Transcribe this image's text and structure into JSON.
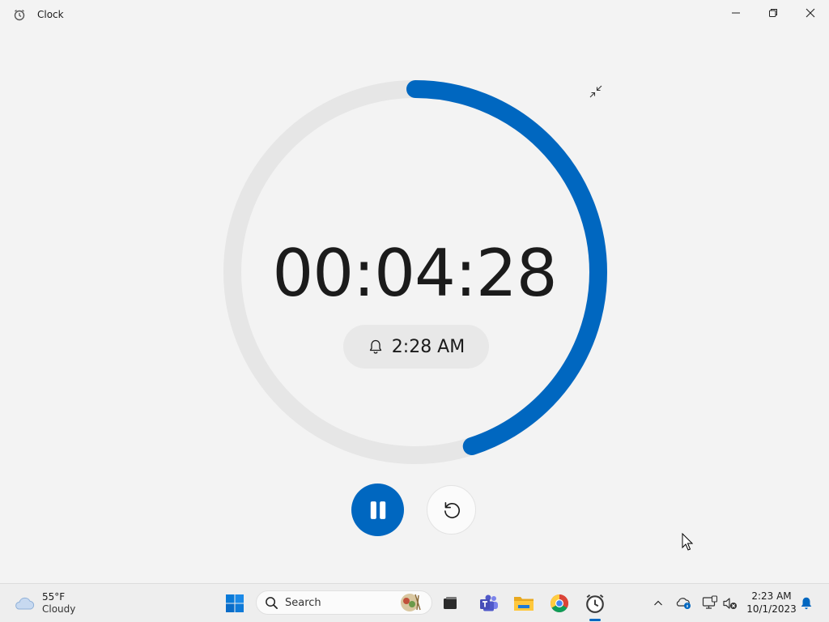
{
  "window": {
    "title": "Clock"
  },
  "timer": {
    "remaining": "00:04:28",
    "alarm_time": "2:28 AM",
    "progress_fraction": 0.45
  },
  "colors": {
    "accent": "#0067c0",
    "track": "#e6e6e6",
    "background": "#f3f3f3"
  },
  "taskbar": {
    "weather": {
      "temperature": "55°F",
      "condition": "Cloudy"
    },
    "search_placeholder": "Search",
    "clock": {
      "time": "2:23 AM",
      "date": "10/1/2023"
    }
  }
}
